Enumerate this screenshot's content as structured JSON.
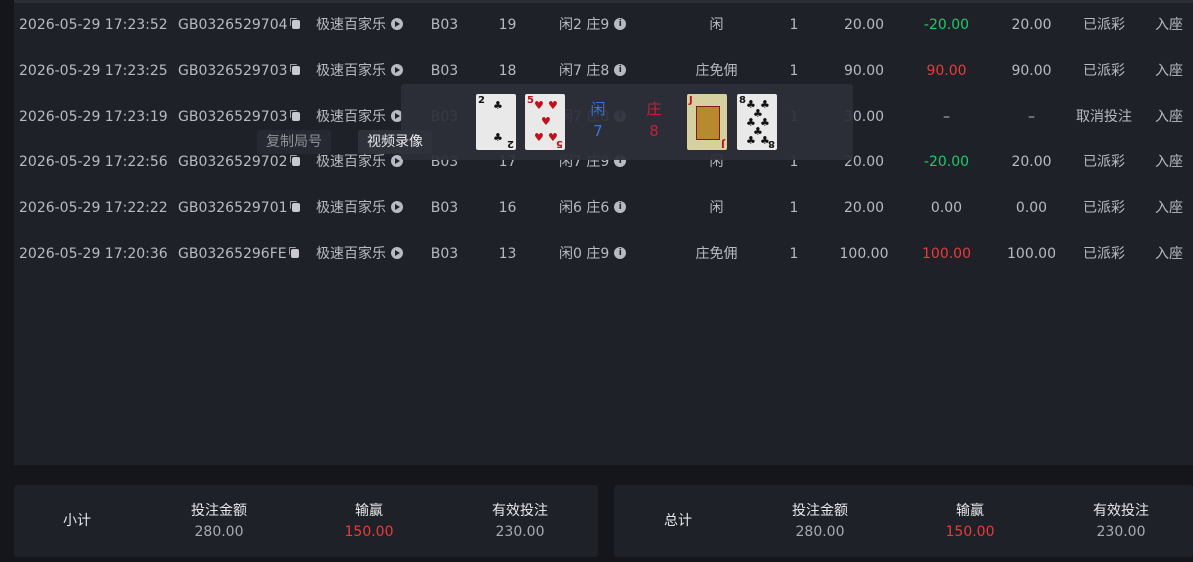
{
  "rows": [
    {
      "time": "2026-05-29 17:23:52",
      "id": "GB0326529704",
      "game": "极速百家乐",
      "table": "B03",
      "shoe": "19",
      "result": "闲2 庄9",
      "bet_type": "闲",
      "count": "1",
      "amount": "20.00",
      "winloss": "-20.00",
      "valid": "20.00",
      "status": "已派彩",
      "seat": "入座"
    },
    {
      "time": "2026-05-29 17:23:25",
      "id": "GB0326529703",
      "game": "极速百家乐",
      "table": "B03",
      "shoe": "18",
      "result": "闲7 庄8",
      "bet_type": "庄免佣",
      "count": "1",
      "amount": "90.00",
      "winloss": "90.00",
      "valid": "90.00",
      "status": "已派彩",
      "seat": "入座"
    },
    {
      "time": "2026-05-29 17:23:19",
      "id": "GB0326529703",
      "game": "极速百家乐",
      "table": "B03",
      "shoe": "18",
      "result": "闲7 庄8",
      "bet_type": "",
      "count": "1",
      "amount": "30.00",
      "winloss": "–",
      "valid": "–",
      "status": "取消投注",
      "seat": "入座"
    },
    {
      "time": "2026-05-29 17:22:56",
      "id": "GB0326529702",
      "game": "极速百家乐",
      "table": "B03",
      "shoe": "17",
      "result": "闲7 庄9",
      "bet_type": "闲",
      "count": "1",
      "amount": "20.00",
      "winloss": "-20.00",
      "valid": "20.00",
      "status": "已派彩",
      "seat": "入座"
    },
    {
      "time": "2026-05-29 17:22:22",
      "id": "GB0326529701",
      "game": "极速百家乐",
      "table": "B03",
      "shoe": "16",
      "result": "闲6 庄6",
      "bet_type": "闲",
      "count": "1",
      "amount": "20.00",
      "winloss": "0.00",
      "valid": "0.00",
      "status": "已派彩",
      "seat": "入座"
    },
    {
      "time": "2026-05-29 17:20:36",
      "id": "GB03265296FE",
      "game": "极速百家乐",
      "table": "B03",
      "shoe": "13",
      "result": "闲0 庄9",
      "bet_type": "庄免佣",
      "count": "1",
      "amount": "100.00",
      "winloss": "100.00",
      "valid": "100.00",
      "status": "已派彩",
      "seat": "入座"
    }
  ],
  "popup": {
    "player_label": "闲",
    "player_score": "7",
    "banker_label": "庄",
    "banker_score": "8",
    "cards": [
      {
        "rank": "2",
        "suit": "♣"
      },
      {
        "rank": "5",
        "suit": "♥"
      },
      {
        "rank": "J",
        "suit": "♥"
      },
      {
        "rank": "8",
        "suit": "♣"
      }
    ]
  },
  "tooltips": {
    "copy": "复制局号",
    "video": "视频录像"
  },
  "subtotal": {
    "title": "小计",
    "bet_label": "投注金额",
    "bet": "280.00",
    "win_label": "输赢",
    "win": "150.00",
    "valid_label": "有效投注",
    "valid": "230.00"
  },
  "total": {
    "title": "总计",
    "bet_label": "投注金额",
    "bet": "280.00",
    "win_label": "输赢",
    "win": "150.00",
    "valid_label": "有效投注",
    "valid": "230.00"
  },
  "colors": {
    "positive": "#ea3a3a",
    "negative": "#1fc86a",
    "player": "#2f77d8",
    "banker": "#c1233a",
    "panel": "#1f2128",
    "background": "#14161b"
  },
  "icons": [
    "copy-icon",
    "play-icon",
    "info-icon"
  ]
}
